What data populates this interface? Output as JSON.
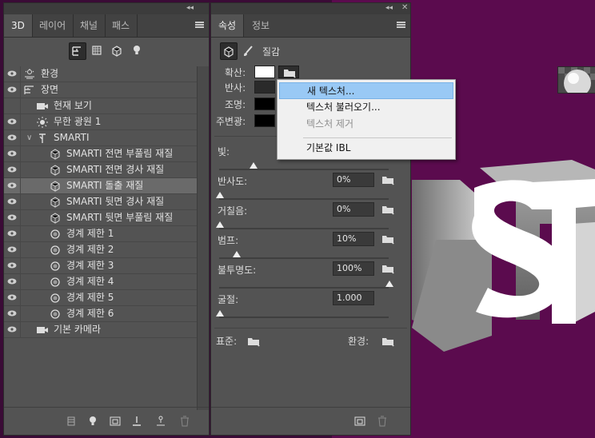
{
  "panel3d": {
    "tabs": [
      {
        "label": "3D"
      },
      {
        "label": "레이어"
      },
      {
        "label": "채널"
      },
      {
        "label": "패스"
      }
    ],
    "rows": [
      {
        "label": "환경"
      },
      {
        "label": "장면"
      },
      {
        "label": "현재 보기"
      },
      {
        "label": "무한 광원 1"
      },
      {
        "label": "SMARTI"
      },
      {
        "label": "SMARTI 전면 부풀림 재질"
      },
      {
        "label": "SMARTI 전면 경사 재질"
      },
      {
        "label": "SMARTI 돌출 재질"
      },
      {
        "label": "SMARTI 뒷면 경사 재질"
      },
      {
        "label": "SMARTI 뒷면 부풀림 재질"
      },
      {
        "label": "경계 제한 1"
      },
      {
        "label": "경계 제한 2"
      },
      {
        "label": "경계 제한 3"
      },
      {
        "label": "경계 제한 4"
      },
      {
        "label": "경계 제한 5"
      },
      {
        "label": "경계 제한 6"
      },
      {
        "label": "기본 카메라"
      }
    ]
  },
  "properties": {
    "tabs": [
      {
        "label": "속성"
      },
      {
        "label": "정보"
      }
    ],
    "header_label": "질감",
    "diffuse_label": "확산:",
    "specular_label": "반사:",
    "illumination_label": "조명:",
    "ambient_label": "주변광:",
    "shine_label": "빛:",
    "reflection_label": "반사도:",
    "reflection_value": "0%",
    "roughness_label": "거칠음:",
    "roughness_value": "0%",
    "bump_label": "범프:",
    "bump_value": "10%",
    "opacity_label": "불투명도:",
    "opacity_value": "100%",
    "refraction_label": "굴절:",
    "refraction_value": "1.000",
    "normal_label": "표준:",
    "environment_label": "환경:"
  },
  "dropdown": {
    "items": [
      {
        "label": "새 텍스처..."
      },
      {
        "label": "텍스처 불러오기..."
      },
      {
        "label": "텍스처 제거"
      },
      {
        "label": "기본값 IBL"
      }
    ]
  },
  "colors": {
    "canvas_bg": "#5b0b4e",
    "highlight": "#99c9f5"
  }
}
